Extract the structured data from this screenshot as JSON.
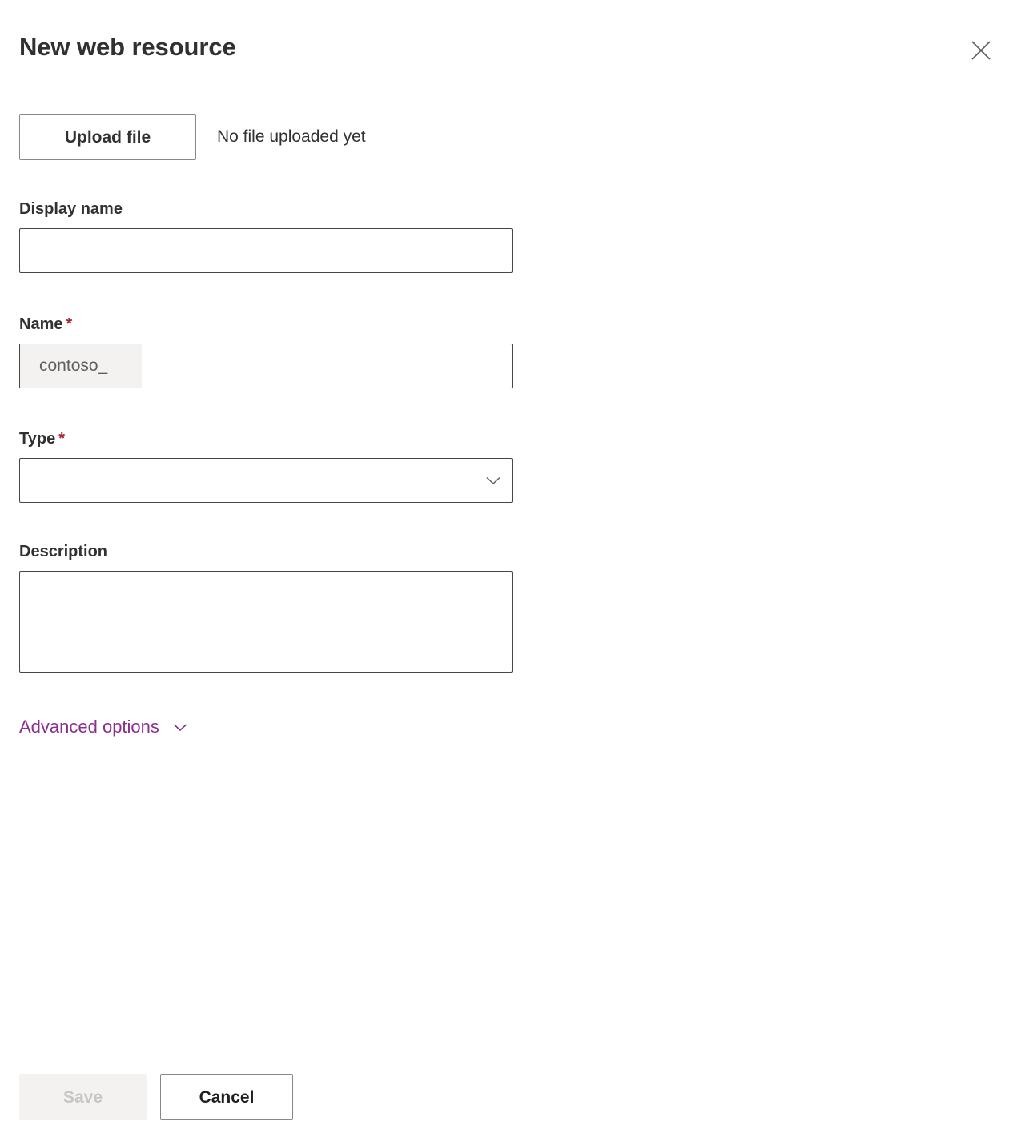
{
  "panel": {
    "title": "New web resource",
    "close_icon": "close-icon"
  },
  "upload": {
    "button_label": "Upload file",
    "status_text": "No file uploaded yet"
  },
  "form": {
    "display_name": {
      "label": "Display name",
      "value": "",
      "placeholder": ""
    },
    "name": {
      "label": "Name",
      "required_marker": "*",
      "prefix": "contoso_",
      "value": "",
      "placeholder": ""
    },
    "type": {
      "label": "Type",
      "required_marker": "*",
      "selected_value": "",
      "chevron_icon": "chevron-down-icon"
    },
    "description": {
      "label": "Description",
      "value": "",
      "placeholder": ""
    },
    "advanced_options": {
      "label": "Advanced options",
      "chevron_icon": "chevron-down-icon"
    }
  },
  "footer": {
    "save_label": "Save",
    "cancel_label": "Cancel"
  },
  "colors": {
    "accent_purple": "#8a2f8f",
    "required_red": "#a4262c",
    "text_primary": "#323130",
    "border_input": "#484644",
    "border_button": "#8a8886",
    "disabled_bg": "#f3f2f1",
    "disabled_text": "#c8c6c4",
    "prefix_bg": "#f3f2f1",
    "background": "#ffffff"
  }
}
